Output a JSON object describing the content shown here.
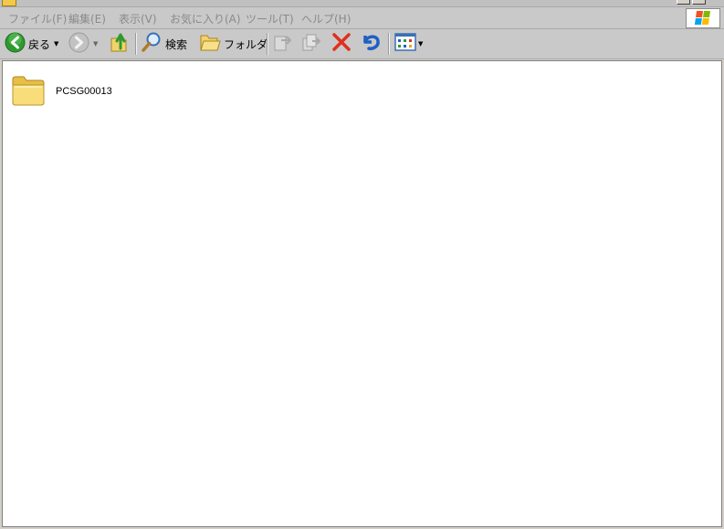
{
  "menubar": {
    "items": [
      {
        "label": "ファイル(F)"
      },
      {
        "label": "編集(E)"
      },
      {
        "label": "表示(V)"
      },
      {
        "label": "お気に入り(A)"
      },
      {
        "label": "ツール(T)"
      },
      {
        "label": "ヘルプ(H)"
      }
    ]
  },
  "toolbar": {
    "back_label": "戻る",
    "search_label": "検索",
    "folders_label": "フォルダ"
  },
  "content": {
    "items": [
      {
        "name": "PCSG00013",
        "icon": "folder-icon"
      }
    ]
  },
  "colors": {
    "back_green": "#2e9a2e",
    "delete_red": "#e0301e",
    "undo_blue": "#1f5fc4",
    "folder_yellow": "#f2d26a"
  }
}
